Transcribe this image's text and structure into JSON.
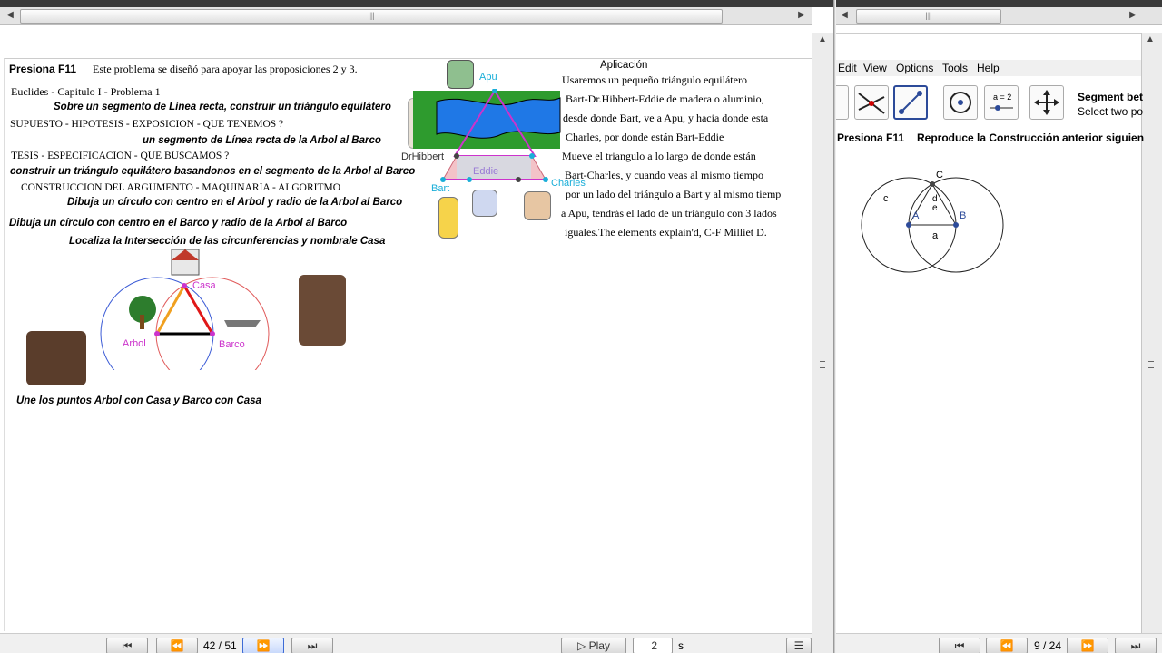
{
  "left": {
    "title_key": "Presiona  F11",
    "intro": "Este problema se diseñó para apoyar las proposiciones 2 y 3.",
    "lines": [
      "Euclides - Capitulo I - Problema  1",
      "Sobre un segmento de Línea recta, construir un triángulo equilátero",
      "SUPUESTO - HIPOTESIS - EXPOSICION - QUE TENEMOS ?",
      "un segmento de Línea recta de la Arbol al Barco",
      "TESIS - ESPECIFICACION - QUE BUSCAMOS ?",
      "construir un triángulo equilátero basandonos en el segmento de la Arbol al Barco",
      "CONSTRUCCION  DEL  ARGUMENTO - MAQUINARIA - ALGORITMO",
      "Dibuja un círculo con centro en el Arbol  y radio de la Arbol al Barco",
      "Dibuja un círculo con centro en el Barco y radio de la Arbol al Barco",
      "Localiza la Intersección de las circunferencias y nombrale Casa"
    ],
    "conclusion": "Une los puntos Arbol con Casa y Barco con Casa",
    "aplicacion_title": "Aplicación",
    "aplicacion_lines": [
      "Usaremos un pequeño triángulo equilátero",
      "Bart-Dr.Hibbert-Eddie de madera o aluminio,",
      "desde donde Bart, ve a Apu, y hacia donde esta",
      "Charles, por donde están Bart-Eddie",
      "Mueve el triangulo a lo largo de donde están",
      "Bart-Charles, y cuando veas al mismo tiempo",
      "por un lado del triángulo a Bart y al mismo tiemp",
      "a Apu, tendrás el lado de un triángulo con 3 lados",
      "iguales.The elements explain'd, C-F Milliet D."
    ],
    "labels": {
      "apu": "Apu",
      "drhibbert": "DrHibbert",
      "eddie": "Eddie",
      "bart": "Bart",
      "charles": "Charles",
      "casa": "Casa",
      "arbol": "Arbol",
      "barco": "Barco"
    },
    "nav": {
      "page": "42 / 51",
      "play": "Play",
      "speed": "2",
      "unit": "s"
    }
  },
  "right": {
    "menu": [
      "Edit",
      "View",
      "Options",
      "Tools",
      "Help"
    ],
    "tool_title": "Segment bet",
    "tool_hint": "Select two po",
    "title_key": "Presiona F11",
    "instruction": "Reproduce la Construcción anterior siguien",
    "labels": {
      "c": "c",
      "C": "C",
      "A": "A",
      "B": "B",
      "a": "a",
      "d": "d",
      "e": "e"
    },
    "nav": {
      "page": "9 / 24"
    }
  },
  "colors": {
    "blue_circle": "#3b5bd6",
    "red_circle": "#e05a5a",
    "magenta": "#cc33cc",
    "cyan": "#1aaed8",
    "selected_tool": "#2c4a99"
  }
}
